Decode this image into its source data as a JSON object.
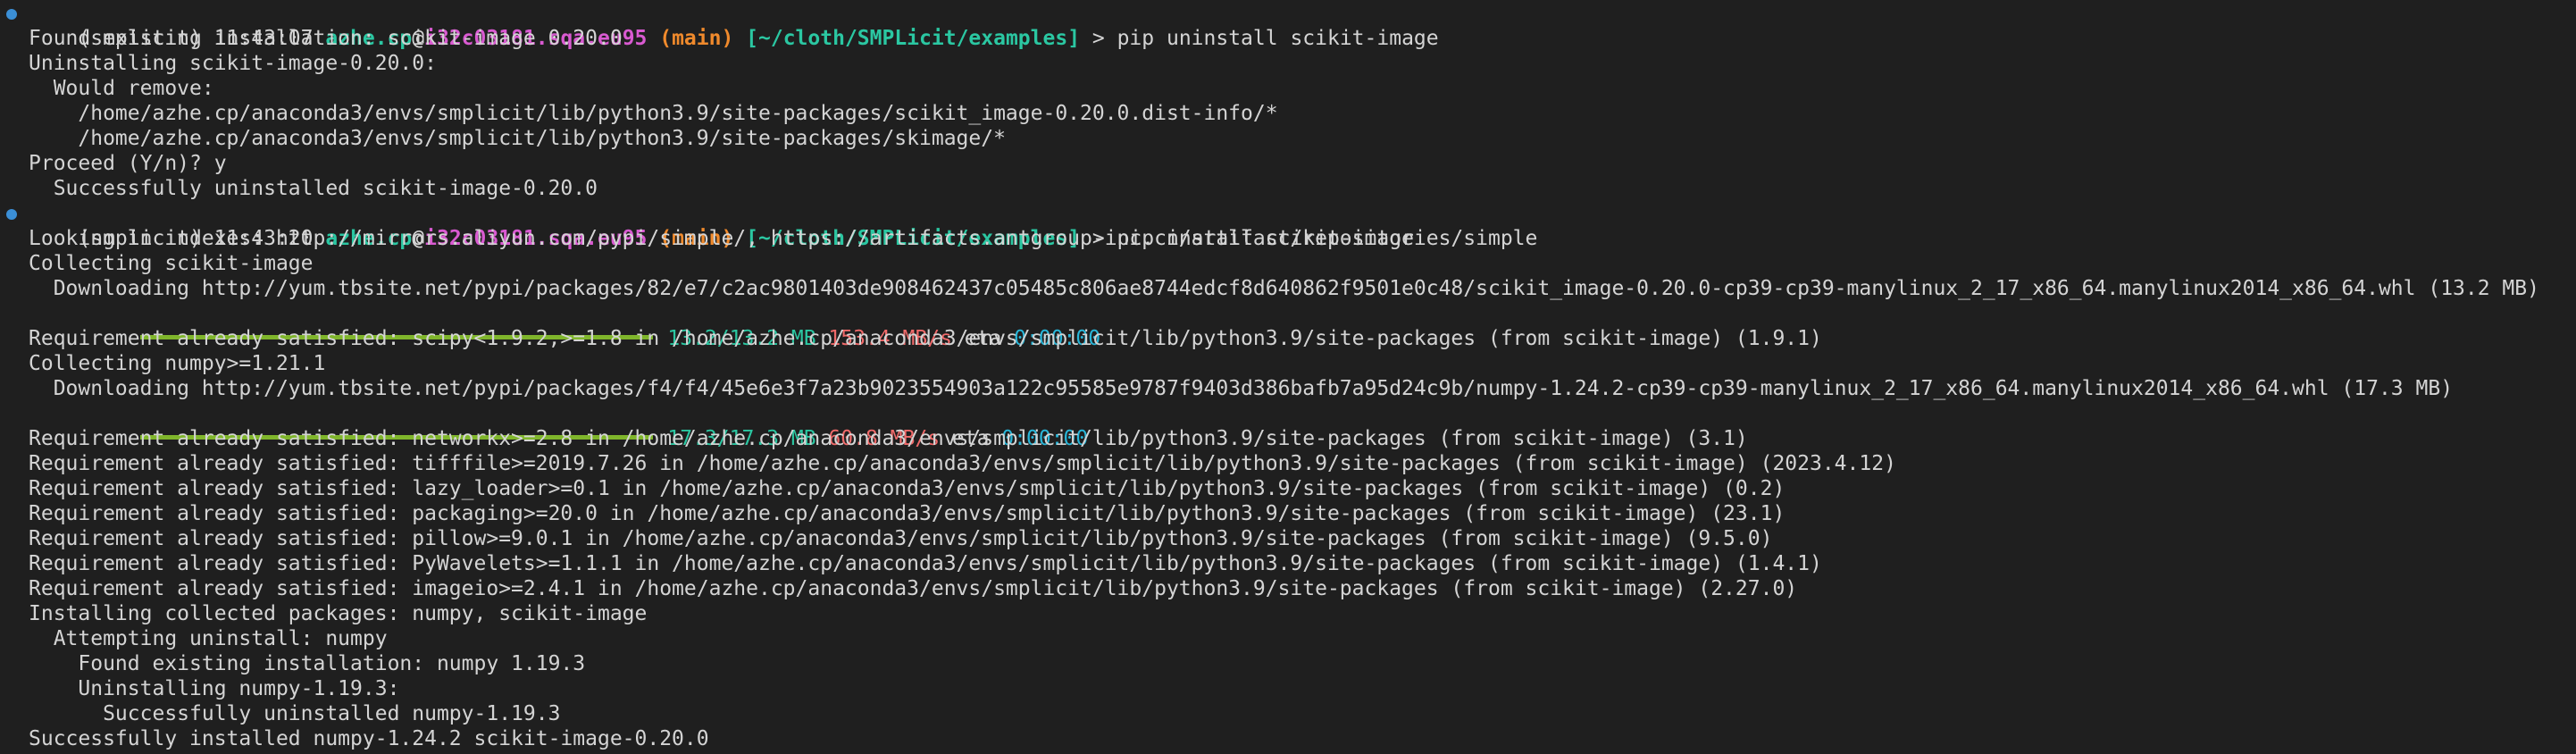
{
  "colors": {
    "background": "#1f1f1f",
    "text": "#d4d4d4",
    "user_host_path": "#2bc7a2",
    "hostname": "#d95ad1",
    "branch": "#f08a2c",
    "progress_bar": "#7fb52b",
    "speed": "#f06a6a",
    "eta": "#29b6d8",
    "marker": "#3b8fd6"
  },
  "prompts": [
    {
      "env": "(smplicit) 11:43:07 ",
      "user": "azhe.cp",
      "at": "@",
      "host": "i32c03181.sqa.eu95",
      "branch": " (main) ",
      "cwd": "[~/cloth/SMPLicit/examples]",
      "command": " > pip uninstall scikit-image"
    },
    {
      "env": "(smplicit) 11:43:20 ",
      "user": "azhe.cp",
      "at": "@",
      "host": "i32c03181.sqa.eu95",
      "branch": " (main) ",
      "cwd": "[~/cloth/SMPLicit/examples]",
      "command": " > pip install scikit-image"
    }
  ],
  "uninstall_output": [
    "Found existing installation: scikit-image 0.20.0",
    "Uninstalling scikit-image-0.20.0:",
    "  Would remove:",
    "    /home/azhe.cp/anaconda3/envs/smplicit/lib/python3.9/site-packages/scikit_image-0.20.0.dist-info/*",
    "    /home/azhe.cp/anaconda3/envs/smplicit/lib/python3.9/site-packages/skimage/*",
    "Proceed (Y/n)? y",
    "  Successfully uninstalled scikit-image-0.20.0"
  ],
  "install_output": {
    "indexes": "Looking in indexes: http://mirrors.aliyun.com/pypi/simple/, https://artifacts.antgroup-inc.cn/artifact/repositories/simple",
    "collecting_scikit": "Collecting scikit-image",
    "downloading_scikit": "  Downloading http://yum.tbsite.net/pypi/packages/82/e7/c2ac9801403de908462437c05485c806ae8744edcf8d640862f9501e0c48/scikit_image-0.20.0-cp39-cp39-manylinux_2_17_x86_64.manylinux2014_x86_64.whl (13.2 MB)",
    "progress1": {
      "fraction": 1.0,
      "size": "13.2/13.2 MB",
      "speed": "153.4 MB/s",
      "eta_label": " eta ",
      "eta": "0:00:00"
    },
    "scipy_req": "Requirement already satisfied: scipy<1.9.2,>=1.8 in /home/azhe.cp/anaconda3/envs/smplicit/lib/python3.9/site-packages (from scikit-image) (1.9.1)",
    "collecting_numpy": "Collecting numpy>=1.21.1",
    "downloading_numpy": "  Downloading http://yum.tbsite.net/pypi/packages/f4/f4/45e6e3f7a23b9023554903a122c95585e9787f9403d386bafb7a95d24c9b/numpy-1.24.2-cp39-cp39-manylinux_2_17_x86_64.manylinux2014_x86_64.whl (17.3 MB)",
    "progress2": {
      "fraction": 1.0,
      "size": "17.3/17.3 MB",
      "speed": "60.8 MB/s",
      "eta_label": " eta ",
      "eta": "0:00:00"
    },
    "requirements": [
      "Requirement already satisfied: networkx>=2.8 in /home/azhe.cp/anaconda3/envs/smplicit/lib/python3.9/site-packages (from scikit-image) (3.1)",
      "Requirement already satisfied: tifffile>=2019.7.26 in /home/azhe.cp/anaconda3/envs/smplicit/lib/python3.9/site-packages (from scikit-image) (2023.4.12)",
      "Requirement already satisfied: lazy_loader>=0.1 in /home/azhe.cp/anaconda3/envs/smplicit/lib/python3.9/site-packages (from scikit-image) (0.2)",
      "Requirement already satisfied: packaging>=20.0 in /home/azhe.cp/anaconda3/envs/smplicit/lib/python3.9/site-packages (from scikit-image) (23.1)",
      "Requirement already satisfied: pillow>=9.0.1 in /home/azhe.cp/anaconda3/envs/smplicit/lib/python3.9/site-packages (from scikit-image) (9.5.0)",
      "Requirement already satisfied: PyWavelets>=1.1.1 in /home/azhe.cp/anaconda3/envs/smplicit/lib/python3.9/site-packages (from scikit-image) (1.4.1)",
      "Requirement already satisfied: imageio>=2.4.1 in /home/azhe.cp/anaconda3/envs/smplicit/lib/python3.9/site-packages (from scikit-image) (2.27.0)"
    ],
    "installing": "Installing collected packages: numpy, scikit-image",
    "attempting": "  Attempting uninstall: numpy",
    "found_numpy": "    Found existing installation: numpy 1.19.3",
    "uninstalling_numpy": "    Uninstalling numpy-1.19.3:",
    "uninstalled_numpy": "      Successfully uninstalled numpy-1.19.3",
    "success": "Successfully installed numpy-1.24.2 scikit-image-0.20.0"
  }
}
